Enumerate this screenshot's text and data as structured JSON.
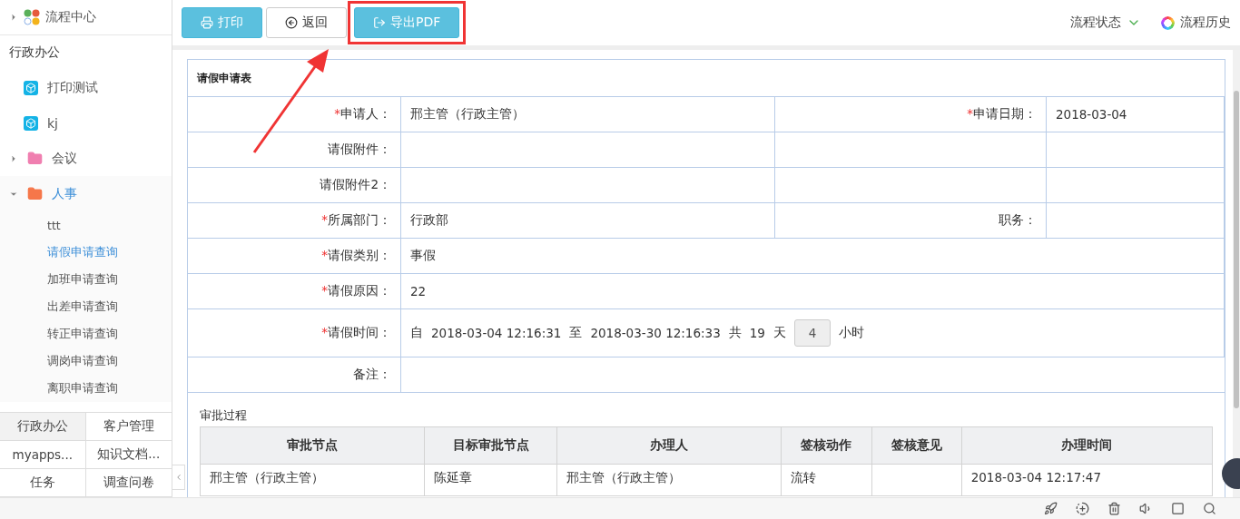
{
  "sidebar": {
    "top": {
      "label": "流程中心",
      "expanded": false
    },
    "section": "行政办公",
    "items": [
      {
        "kind": "app",
        "label": "打印测试"
      },
      {
        "kind": "app",
        "label": "kj"
      },
      {
        "kind": "folder",
        "label": "会议",
        "color": "#f07fb0",
        "expanded": false,
        "selected": false
      },
      {
        "kind": "folder",
        "label": "人事",
        "color": "#f6774a",
        "expanded": true,
        "selected": true,
        "children": [
          {
            "label": "ttt",
            "selected": false
          },
          {
            "label": "请假申请查询",
            "selected": true
          },
          {
            "label": "加班申请查询",
            "selected": false
          },
          {
            "label": "出差申请查询",
            "selected": false
          },
          {
            "label": "转正申请查询",
            "selected": false
          },
          {
            "label": "调岗申请查询",
            "selected": false
          },
          {
            "label": "离职申请查询",
            "selected": false
          }
        ]
      }
    ],
    "tabs": [
      {
        "label": "行政办公",
        "selected": true
      },
      {
        "label": "客户管理",
        "selected": false
      },
      {
        "label": "myapps...",
        "selected": false
      },
      {
        "label": "知识文档...",
        "selected": false
      },
      {
        "label": "任务",
        "selected": false
      },
      {
        "label": "调查问卷",
        "selected": false
      }
    ]
  },
  "toolbar": {
    "buttons": [
      {
        "kind": "primary",
        "label": "打印",
        "highlighted": false
      },
      {
        "kind": "default",
        "label": "返回",
        "highlighted": false
      },
      {
        "kind": "primary",
        "label": "导出PDF",
        "highlighted": true
      }
    ],
    "status": "流程状态",
    "history": "流程历史"
  },
  "form": {
    "title": "请假申请表",
    "rows": [
      {
        "kind": "pair",
        "marker": "*",
        "label": "申请人：",
        "value": "邢主管（行政主管）",
        "marker2": "*",
        "label2": "申请日期：",
        "value2": "2018-03-04"
      },
      {
        "kind": "pair",
        "label": "请假附件："
      },
      {
        "kind": "pair",
        "label": "请假附件2："
      },
      {
        "kind": "pair",
        "marker": "*",
        "label": "所属部门：",
        "value": "行政部",
        "label2": "职务："
      },
      {
        "kind": "single",
        "marker": "*",
        "label": "请假类别：",
        "value": "事假"
      },
      {
        "kind": "single",
        "marker": "*",
        "label": "请假原因：",
        "value": "22"
      },
      {
        "kind": "time",
        "marker": "*",
        "label": "请假时间：",
        "from_label": "自",
        "from": "2018-03-04 12:16:31",
        "to_label": "至",
        "to": "2018-03-30 12:16:33",
        "total_label": "共",
        "days": "19",
        "days_unit": "天",
        "hours": "4",
        "hours_unit": "小时"
      },
      {
        "kind": "single",
        "label": "备注："
      }
    ]
  },
  "approval": {
    "title": "审批过程",
    "columns": [
      "审批节点",
      "目标审批节点",
      "办理人",
      "签核动作",
      "签核意见",
      "办理时间"
    ],
    "rows": [
      [
        "邢主管（行政主管）",
        "陈延章",
        "邢主管（行政主管）",
        "流转",
        "",
        "2018-03-04 12:17:47"
      ]
    ]
  }
}
